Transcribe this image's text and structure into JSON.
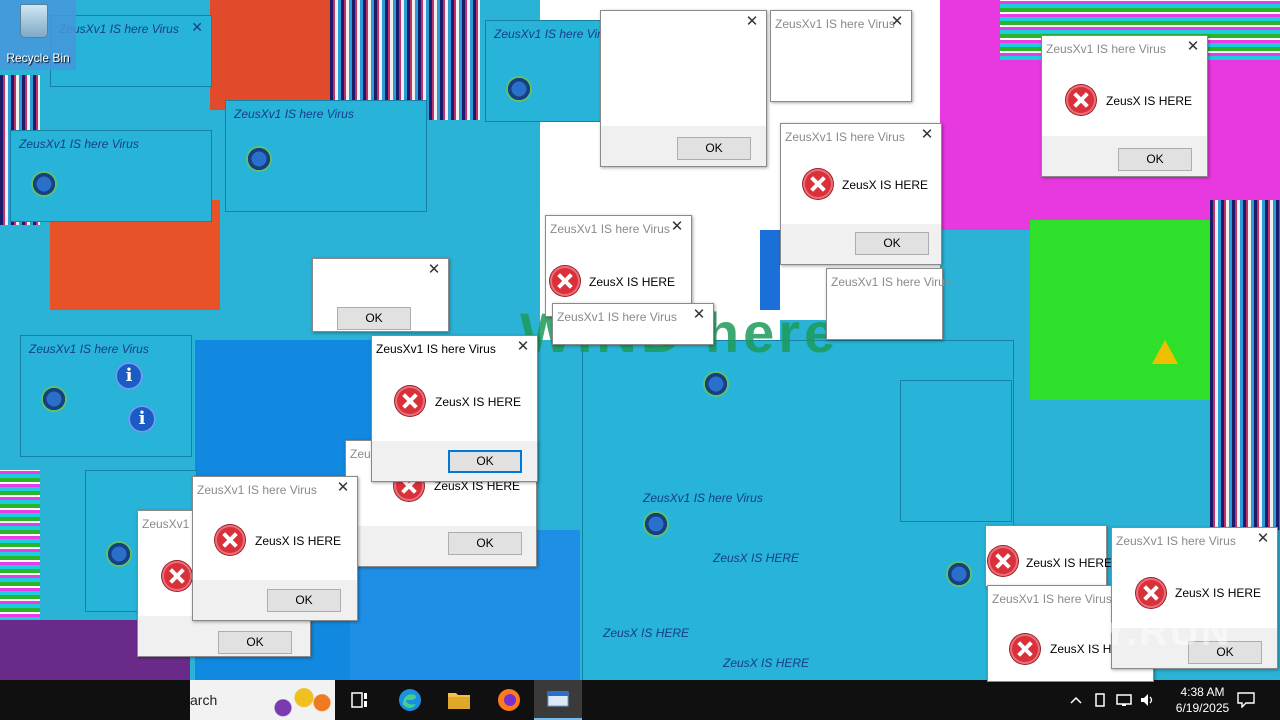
{
  "desktop": {
    "recycle_bin_label": "Recycle Bin",
    "overlay_text": "WIND here"
  },
  "virus": {
    "title": "ZeusXv1 IS here Virus",
    "title_truncated": "ZeusXv1 IS here Virus",
    "message": "ZeusX IS HERE",
    "ok_label": "OK"
  },
  "ghost_titles": [
    "ZeusXv1 IS here Virus",
    "ZeusXv1 IS here Virus",
    "ZeusXv1 IS here Virus",
    "ZeusXv1 IS here Virus",
    "ZeusXv1 IS here Virus",
    "ZeusXv1 IS here Virus"
  ],
  "ghost_messages": [
    "ZeusX IS HERE",
    "ZeusX IS HERE",
    "ZeusX IS HERE"
  ],
  "taskbar": {
    "search_text": "arch",
    "time": "4:38 AM",
    "date": "6/19/2025"
  },
  "watermark": "ANY.RUN",
  "colors": {
    "error_red": "#d9303a",
    "taskbar": "#101010",
    "desktop_blue": "#0d8fd6"
  }
}
